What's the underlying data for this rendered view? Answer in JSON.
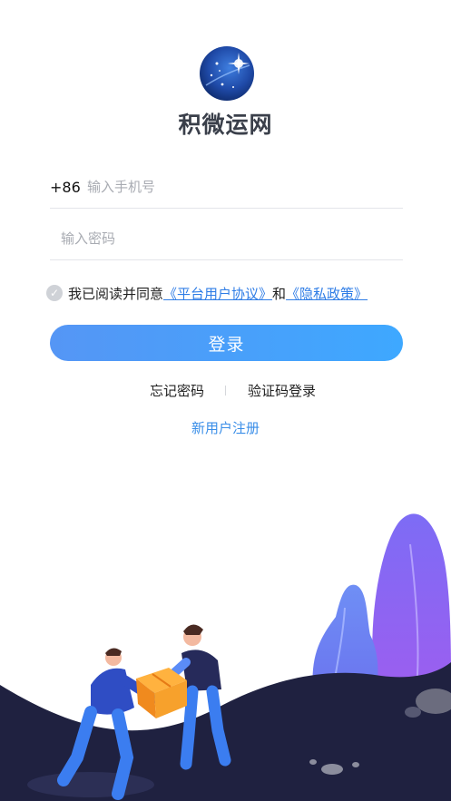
{
  "app": {
    "name": "积微运网",
    "logo_icon": "starry-globe-logo"
  },
  "phone": {
    "country_code": "+86",
    "placeholder": "输入手机号",
    "value": ""
  },
  "password": {
    "placeholder": "输入密码",
    "value": ""
  },
  "agreement": {
    "prefix": "我已阅读并同意",
    "terms_label": "《平台用户协议》",
    "conjunction": "和",
    "privacy_label": "《隐私政策》",
    "checked": false,
    "check_icon": "checkmark-icon"
  },
  "login_button": {
    "label": "登录"
  },
  "links": {
    "forgot_password": "忘记密码",
    "code_login": "验证码登录",
    "register": "新用户注册"
  },
  "colors": {
    "accent": "#3ea8ff",
    "link": "#2f7de6",
    "hill_dark": "#1f2140",
    "plant_purple": "#8a6cf2"
  }
}
